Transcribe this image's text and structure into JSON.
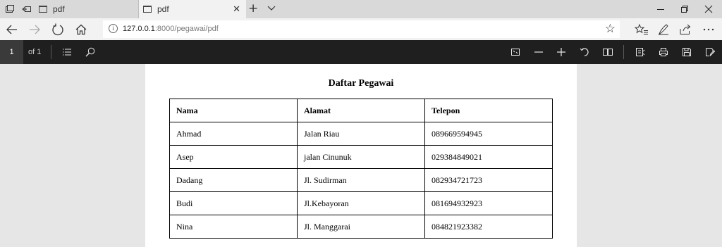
{
  "tabs": [
    {
      "label": "pdf",
      "active": false
    },
    {
      "label": "pdf",
      "active": true
    }
  ],
  "address_bar": {
    "url_host": "127.0.0.1",
    "url_rest": ":8000/pegawai/pdf"
  },
  "pdf_toolbar": {
    "page_number": "1",
    "page_total": "of 1"
  },
  "document": {
    "title": "Daftar Pegawai",
    "columns": [
      "Nama",
      "Alamat",
      "Telepon"
    ],
    "rows": [
      [
        "Ahmad",
        "Jalan Riau",
        "089669594945"
      ],
      [
        "Asep",
        "jalan Cinunuk",
        "029384849021"
      ],
      [
        "Dadang",
        "Jl. Sudirman",
        "082934721723"
      ],
      [
        "Budi",
        "Jl.Kebayoran",
        "081694932923"
      ],
      [
        "Nina",
        "Jl. Manggarai",
        "084821923382"
      ]
    ]
  },
  "colors": {
    "pdf_toolbar_bg": "#1f1f1f",
    "tabstrip_bg": "#d9d9d9",
    "active_tab_bg": "#f2f2f2",
    "viewer_bg": "#e6e6e6"
  },
  "icons": [
    "tab-preview-icon",
    "set-aside-tabs-icon",
    "close-icon",
    "new-tab-icon",
    "chevron-down-icon",
    "minimize-icon",
    "restore-icon",
    "back-icon",
    "forward-icon",
    "refresh-icon",
    "home-icon",
    "info-icon",
    "star-icon",
    "favorites-icon",
    "pen-icon",
    "share-icon",
    "more-icon",
    "contents-icon",
    "search-icon",
    "fit-page-icon",
    "zoom-out-icon",
    "zoom-in-icon",
    "rotate-icon",
    "page-view-icon",
    "read-aloud-icon",
    "print-icon",
    "save-icon",
    "save-as-icon"
  ]
}
